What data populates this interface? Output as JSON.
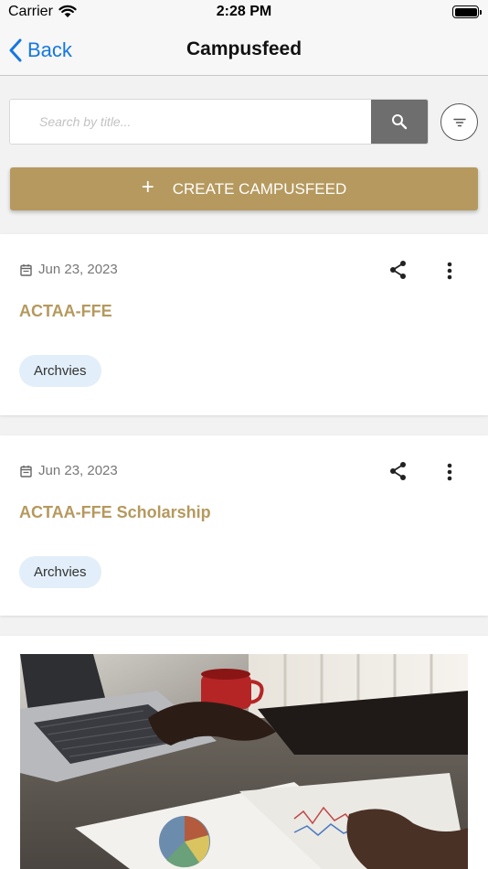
{
  "status_bar": {
    "carrier": "Carrier",
    "time": "2:28 PM"
  },
  "nav": {
    "back_label": "Back",
    "title": "Campusfeed"
  },
  "search": {
    "placeholder": "Search by title..."
  },
  "create_button": {
    "label": "CREATE CAMPUSFEED"
  },
  "feed": [
    {
      "date": "Jun 23, 2023",
      "title": "ACTAA-FFE",
      "tag": "Archvies"
    },
    {
      "date": "Jun 23, 2023",
      "title": "ACTAA-FFE Scholarship",
      "tag": "Archvies"
    }
  ],
  "colors": {
    "accent": "#b5995e",
    "link_blue": "#1677e0",
    "search_button": "#6e6e6e",
    "tag_background": "#e2eef9"
  },
  "icons": [
    "wifi-icon",
    "battery-icon",
    "chevron-left-icon",
    "search-icon",
    "filter-icon",
    "plus-icon",
    "calendar-icon",
    "share-icon",
    "more-vertical-icon"
  ]
}
